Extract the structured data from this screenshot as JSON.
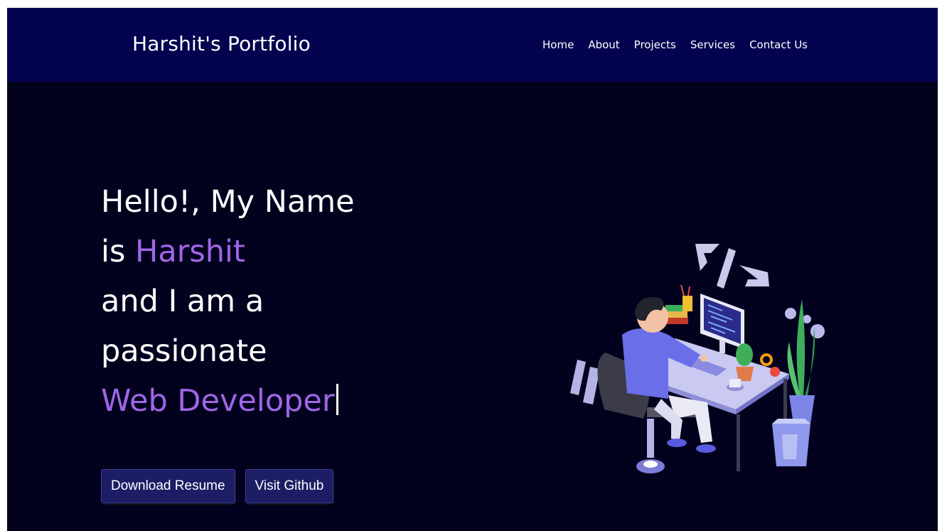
{
  "navbar": {
    "brand": "Harshit's Portfolio",
    "links": [
      "Home",
      "About",
      "Projects",
      "Services",
      "Contact Us"
    ]
  },
  "hero": {
    "line1": "Hello!, My Name",
    "line2_prefix": "is ",
    "name": "Harshit",
    "line3": "and I am a",
    "line4": "passionate",
    "role": "Web Developer"
  },
  "buttons": {
    "download": "Download Resume",
    "github": "Visit Github"
  },
  "colors": {
    "nav_bg": "#03034f",
    "page_bg": "#02021f",
    "accent": "#a066e6",
    "button_bg": "#1d1d66"
  },
  "illustration": "developer-at-desk-illustration"
}
